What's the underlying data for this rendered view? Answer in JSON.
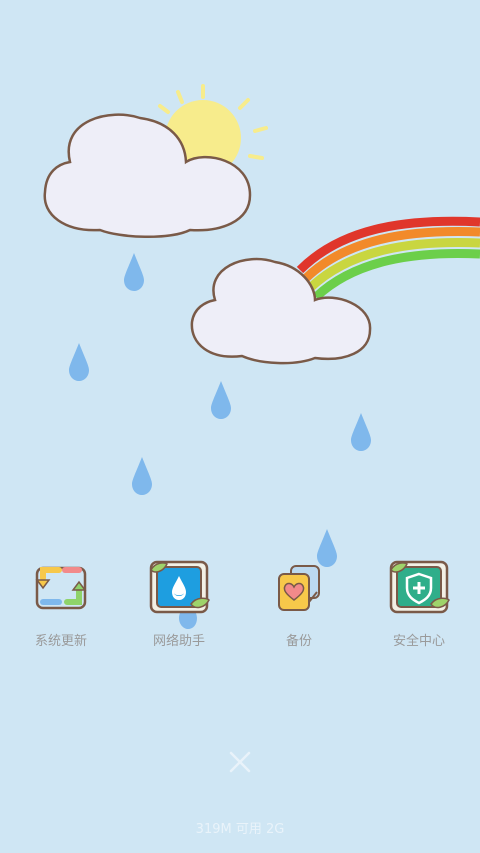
{
  "apps": [
    {
      "label": "系统更新",
      "icon": "system-update-icon"
    },
    {
      "label": "网络助手",
      "icon": "network-assistant-icon"
    },
    {
      "label": "备份",
      "icon": "backup-icon"
    },
    {
      "label": "安全中心",
      "icon": "security-center-icon"
    }
  ],
  "close_icon": "close-icon",
  "memory_status": "319M 可用 2G",
  "colors": {
    "background": "#cfe6f4",
    "raindrop": "#7fb8ec",
    "sun": "#f7ec8c",
    "cloud_fill": "#eeeef8",
    "cloud_stroke": "#7a5a48",
    "rainbow": [
      "#e0362b",
      "#f28a2a",
      "#c9d640",
      "#6ccf4a"
    ],
    "label_text": "#9a9a9a"
  }
}
